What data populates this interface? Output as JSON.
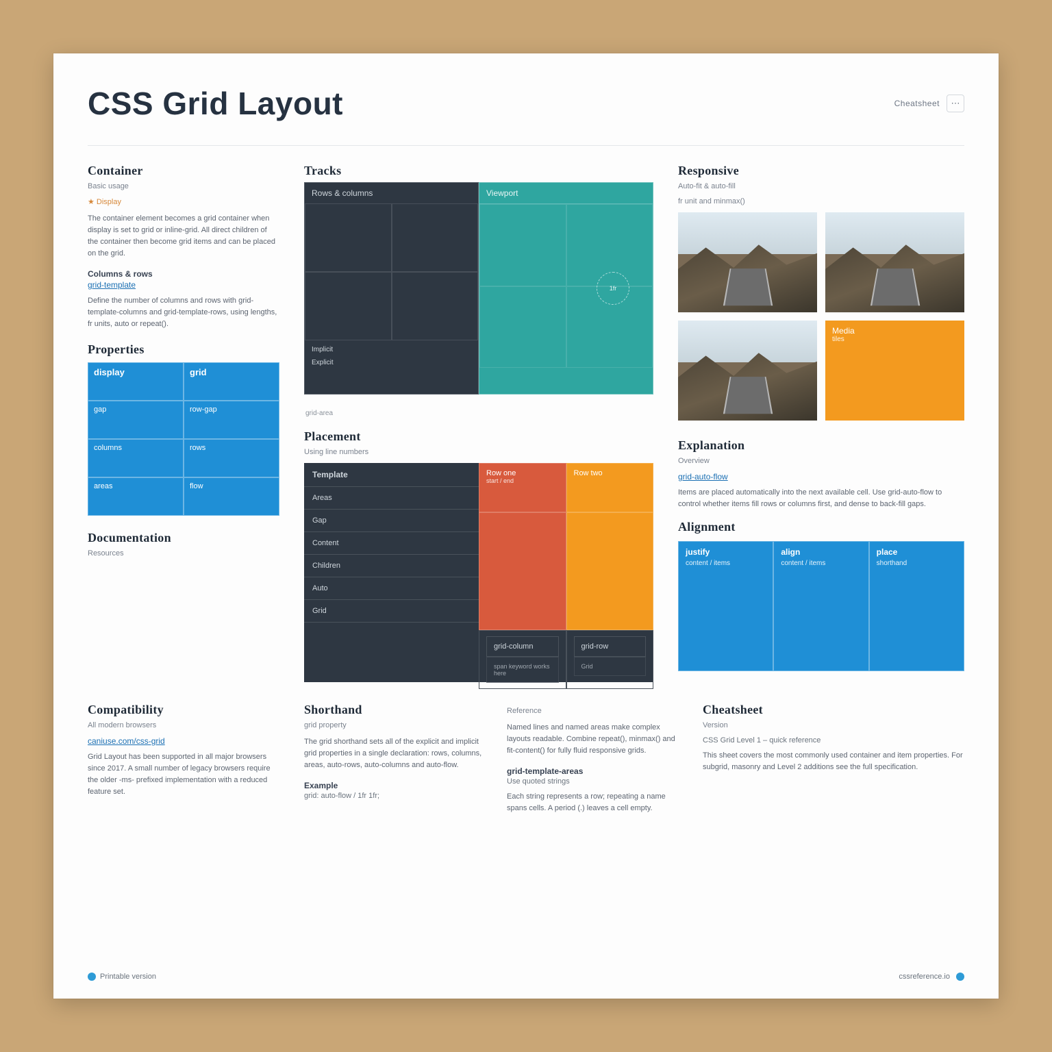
{
  "header": {
    "title": "CSS Grid Layout",
    "crumb": "Cheatsheet"
  },
  "left": {
    "section1": {
      "heading": "Container",
      "sub": "Basic usage",
      "badge": "★ Display",
      "para1": "The container element becomes a grid container when display is set to grid or inline-grid. All direct children of the container then become grid items and can be placed on the grid.",
      "label1": "Columns & rows",
      "label1_link": "grid-template",
      "para2": "Define the number of columns and rows with grid-template-columns and grid-template-rows, using lengths, fr units, auto or repeat()."
    },
    "section2": {
      "heading": "Properties",
      "cells": [
        "display",
        "grid",
        "gap",
        "row-gap",
        "columns",
        "rows",
        "areas",
        "flow"
      ]
    },
    "section3": {
      "heading": "Documentation",
      "sub": "Resources"
    }
  },
  "center": {
    "section1": {
      "heading": "Tracks",
      "sub_dark": "Rows & columns",
      "sub_dark2": "Implicit",
      "sub_dark3": "Explicit",
      "sub_teal": "Viewport",
      "circle": "1fr",
      "foot": "grid-area"
    },
    "section2": {
      "heading": "Placement",
      "sub": "Using line numbers",
      "rows": [
        "Template",
        "Areas",
        "Gap",
        "Content",
        "Children",
        "Auto",
        "Grid"
      ],
      "red": "Row one",
      "red_sub": "start / end",
      "orange": "Row two",
      "foot_l": "grid-column",
      "foot_l2": "span keyword works here",
      "foot_r": "grid-row",
      "foot_g": "Grid"
    }
  },
  "right": {
    "section1": {
      "heading": "Responsive",
      "sub": "Auto-fit & auto-fill",
      "sub2": "fr unit and minmax()",
      "orange_label": "Media",
      "orange_sub": "tiles"
    },
    "section2": {
      "heading": "Explanation",
      "sub": "Overview",
      "link": "grid-auto-flow",
      "para": "Items are placed automatically into the next available cell. Use grid-auto-flow to control whether items fill rows or columns first, and dense to back-fill gaps."
    },
    "section3": {
      "heading": "Alignment",
      "cols": [
        {
          "hd": "justify",
          "val": "content / items"
        },
        {
          "hd": "align",
          "val": "content / items"
        },
        {
          "hd": "place",
          "val": "shorthand"
        }
      ]
    }
  },
  "bottom": {
    "col1": {
      "heading": "Compatibility",
      "sub": "All modern browsers",
      "link": "caniuse.com/css-grid",
      "para": "Grid Layout has been supported in all major browsers since 2017. A small number of legacy browsers require the older -ms- prefixed implementation with a reduced feature set."
    },
    "col2": {
      "heading": "Shorthand",
      "sub": "grid property",
      "para": "The grid shorthand sets all of the explicit and implicit grid properties in a single declaration: rows, columns, areas, auto-rows, auto-columns and auto-flow.",
      "label": "Example",
      "minor": "grid: auto-flow / 1fr 1fr;"
    },
    "col3": {
      "sub": "Reference",
      "para": "Named lines and named areas make complex layouts readable. Combine repeat(), minmax() and fit-content() for fully fluid responsive grids.",
      "label": "grid-template-areas",
      "minor": "Use quoted strings",
      "para2": "Each string represents a row; repeating a name spans cells. A period (.) leaves a cell empty."
    },
    "col4": {
      "heading": "Cheatsheet",
      "sub": "Version",
      "minor": "CSS Grid Level 1 – quick reference",
      "para": "This sheet covers the most commonly used container and item properties. For subgrid, masonry and Level 2 additions see the full specification."
    }
  },
  "footer": {
    "left": "Printable version",
    "right": "cssreference.io"
  }
}
